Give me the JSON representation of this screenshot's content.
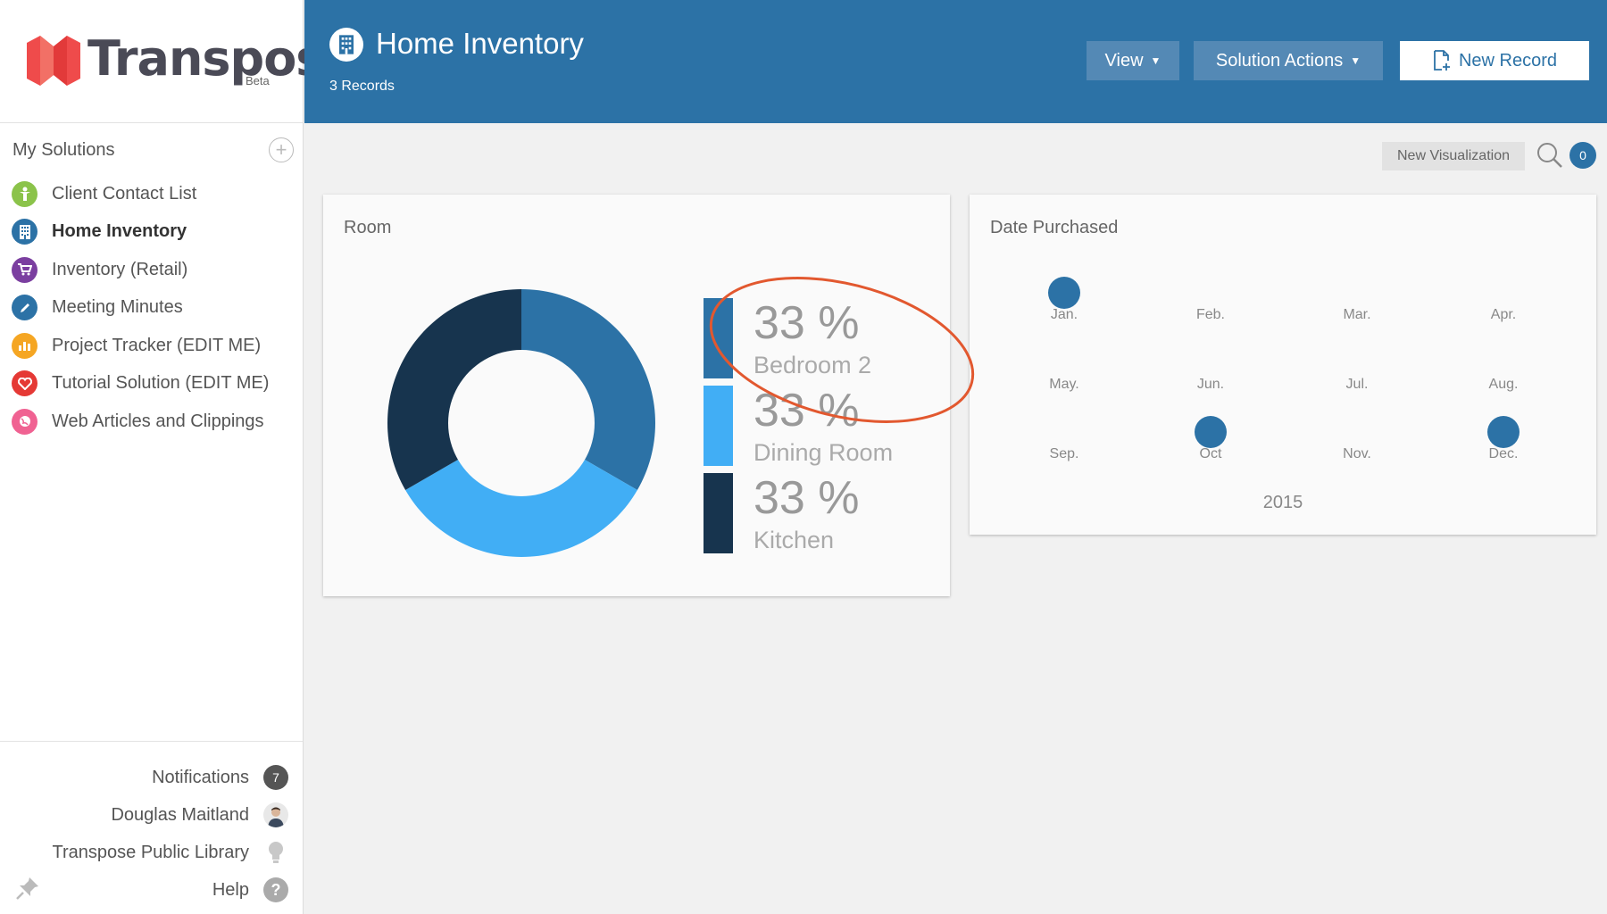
{
  "brand": {
    "name": "Transpose",
    "badge": "Beta"
  },
  "sidebar": {
    "header": "My Solutions",
    "items": [
      {
        "label": "Client Contact List",
        "color": "#8bc34a",
        "icon": "person-icon"
      },
      {
        "label": "Home Inventory",
        "color": "#2c72a6",
        "icon": "building-icon",
        "active": true
      },
      {
        "label": "Inventory (Retail)",
        "color": "#7b3fa0",
        "icon": "cart-icon"
      },
      {
        "label": "Meeting Minutes",
        "color": "#2c72a6",
        "icon": "pencil-icon"
      },
      {
        "label": "Project Tracker (EDIT ME)",
        "color": "#f5a623",
        "icon": "chart-icon"
      },
      {
        "label": "Tutorial Solution (EDIT ME)",
        "color": "#e53935",
        "icon": "heart-icon"
      },
      {
        "label": "Web Articles and Clippings",
        "color": "#f06292",
        "icon": "globe-icon"
      }
    ],
    "bottom": {
      "notifications": "Notifications",
      "notifications_count": "7",
      "user": "Douglas Maitland",
      "library": "Transpose Public Library",
      "help": "Help"
    }
  },
  "header": {
    "title": "Home Inventory",
    "subtitle": "3 Records",
    "view": "View",
    "solution_actions": "Solution Actions",
    "new_record": "New Record"
  },
  "toolbar": {
    "new_visualization": "New Visualization",
    "count": "0"
  },
  "room_card": {
    "title": "Room",
    "legend": [
      {
        "pct": "33 %",
        "label": "Bedroom 2",
        "color": "#2c72a6"
      },
      {
        "pct": "33 %",
        "label": "Dining Room",
        "color": "#41aef5"
      },
      {
        "pct": "33 %",
        "label": "Kitchen",
        "color": "#17344e"
      }
    ]
  },
  "date_card": {
    "title": "Date Purchased",
    "months": [
      "Jan.",
      "Feb.",
      "Mar.",
      "Apr.",
      "May.",
      "Jun.",
      "Jul.",
      "Aug.",
      "Sep.",
      "Oct",
      "Nov.",
      "Dec."
    ],
    "marked": [
      "Jan.",
      "Oct",
      "Dec."
    ],
    "year": "2015"
  },
  "chart_data": {
    "type": "pie",
    "title": "Room",
    "categories": [
      "Bedroom 2",
      "Dining Room",
      "Kitchen"
    ],
    "values": [
      33,
      33,
      33
    ],
    "colors": [
      "#2c72a6",
      "#41aef5",
      "#17344e"
    ],
    "legend": "right"
  }
}
